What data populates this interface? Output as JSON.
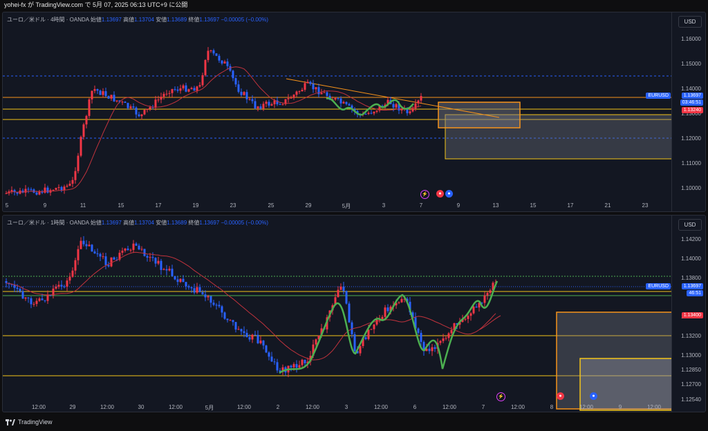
{
  "topbar": {
    "text": "yohei-fx が TradingView.com で 5月 07, 2025 06:13 UTC+9 に公開"
  },
  "panel1": {
    "symbol": "ユーロ／米ドル · 4時間 · OANDA",
    "open_label": "始値",
    "open": "1.13697",
    "high_label": "高値",
    "high": "1.13704",
    "low_label": "安値",
    "low": "1.13689",
    "close_label": "終値",
    "close": "1.13697",
    "change": "−0.00005 (−0.00%)",
    "currency": "USD",
    "price_ticks": [
      "1.16000",
      "1.15000",
      "1.14000",
      "1.13000",
      "1.12000",
      "1.11000",
      "1.10000"
    ],
    "symbol_tag": "EURUSD",
    "price_tag": "1.13697",
    "countdown_tag": "03:46:51",
    "level_tag": "1.13240",
    "x_labels": [
      "5",
      "9",
      "11",
      "15",
      "17",
      "19",
      "23",
      "25",
      "29",
      "5月",
      "3",
      "7",
      "9",
      "13",
      "15",
      "17",
      "21",
      "23"
    ]
  },
  "panel2": {
    "symbol": "ユーロ／米ドル · 1時間 · OANDA",
    "open_label": "始値",
    "open": "1.13697",
    "high_label": "高値",
    "high": "1.13704",
    "low_label": "安値",
    "low": "1.13689",
    "close_label": "終値",
    "close": "1.13697",
    "change": "−0.00005 (−0.00%)",
    "currency": "USD",
    "price_ticks": [
      "1.14200",
      "1.14000",
      "1.13800",
      "1.13400",
      "1.13200",
      "1.13000",
      "1.12850",
      "1.12700",
      "1.12540"
    ],
    "symbol_tag": "EURUSD",
    "price_tag": "1.13697",
    "countdown_tag": "46:51",
    "level_tag": "1.13400",
    "x_labels": [
      "12:00",
      "29",
      "12:00",
      "30",
      "12:00",
      "5月",
      "12:00",
      "2",
      "12:00",
      "3",
      "12:00",
      "6",
      "12:00",
      "7",
      "12:00",
      "8",
      "12:00",
      "9",
      "12:00"
    ]
  },
  "footer": {
    "brand": "TradingView"
  },
  "colors": {
    "up": "#f23645",
    "down": "#2962ff",
    "ma": "#c2333d",
    "wave": "#4caf50",
    "level": "#f5c518",
    "accent_orange": "#f7931a"
  }
}
